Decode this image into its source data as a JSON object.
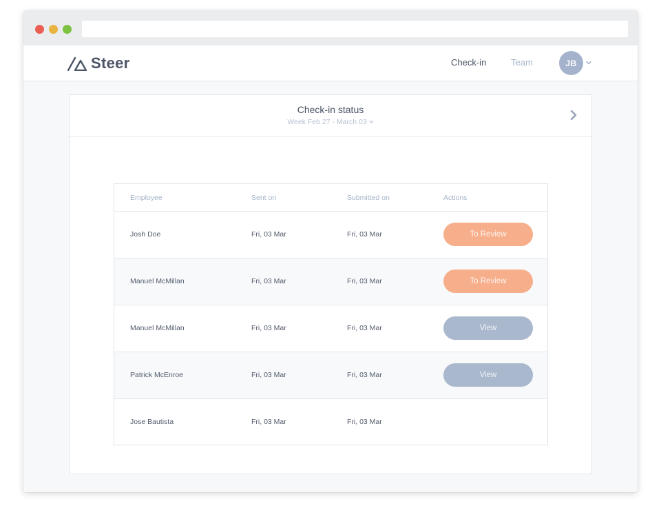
{
  "browser": {
    "url": ""
  },
  "nav": {
    "brand": "Steer",
    "links": [
      "Check-in",
      "Team"
    ],
    "user_initials": "JB"
  },
  "page": {
    "title": "Check-in status",
    "week": "Week Feb 27 - March 03"
  },
  "table": {
    "columns": [
      "Employee",
      "Sent on",
      "Submitted on",
      "Actions"
    ],
    "rows": [
      {
        "employee": "Josh Doe",
        "sent_on": "Fri, 03 Mar",
        "submitted_on": "Fri, 03 Mar",
        "action": "To Review"
      },
      {
        "employee": "Manuel McMillan",
        "sent_on": "Fri, 03 Mar",
        "submitted_on": "Fri, 03 Mar",
        "action": "To Review"
      },
      {
        "employee": "Manuel McMillan",
        "sent_on": "Fri, 03 Mar",
        "submitted_on": "Fri, 03 Mar",
        "action": "View"
      },
      {
        "employee": "Patrick McEnroe",
        "sent_on": "Fri, 03 Mar",
        "submitted_on": "Fri, 03 Mar",
        "action": "View"
      },
      {
        "employee": "Jose Bautista",
        "sent_on": "Fri, 03 Mar",
        "submitted_on": "Fri, 03 Mar",
        "action": ""
      }
    ]
  },
  "colors": {
    "review_button": "#f7ae8b",
    "view_button": "#aab8cd",
    "text_dark": "#4a5263",
    "text_muted": "#a4b3c8"
  },
  "icons": [
    "window-close-dot",
    "window-minimize-dot",
    "window-zoom-dot",
    "steer-logo-icon",
    "chevron-down-icon",
    "chevron-right-icon"
  ]
}
